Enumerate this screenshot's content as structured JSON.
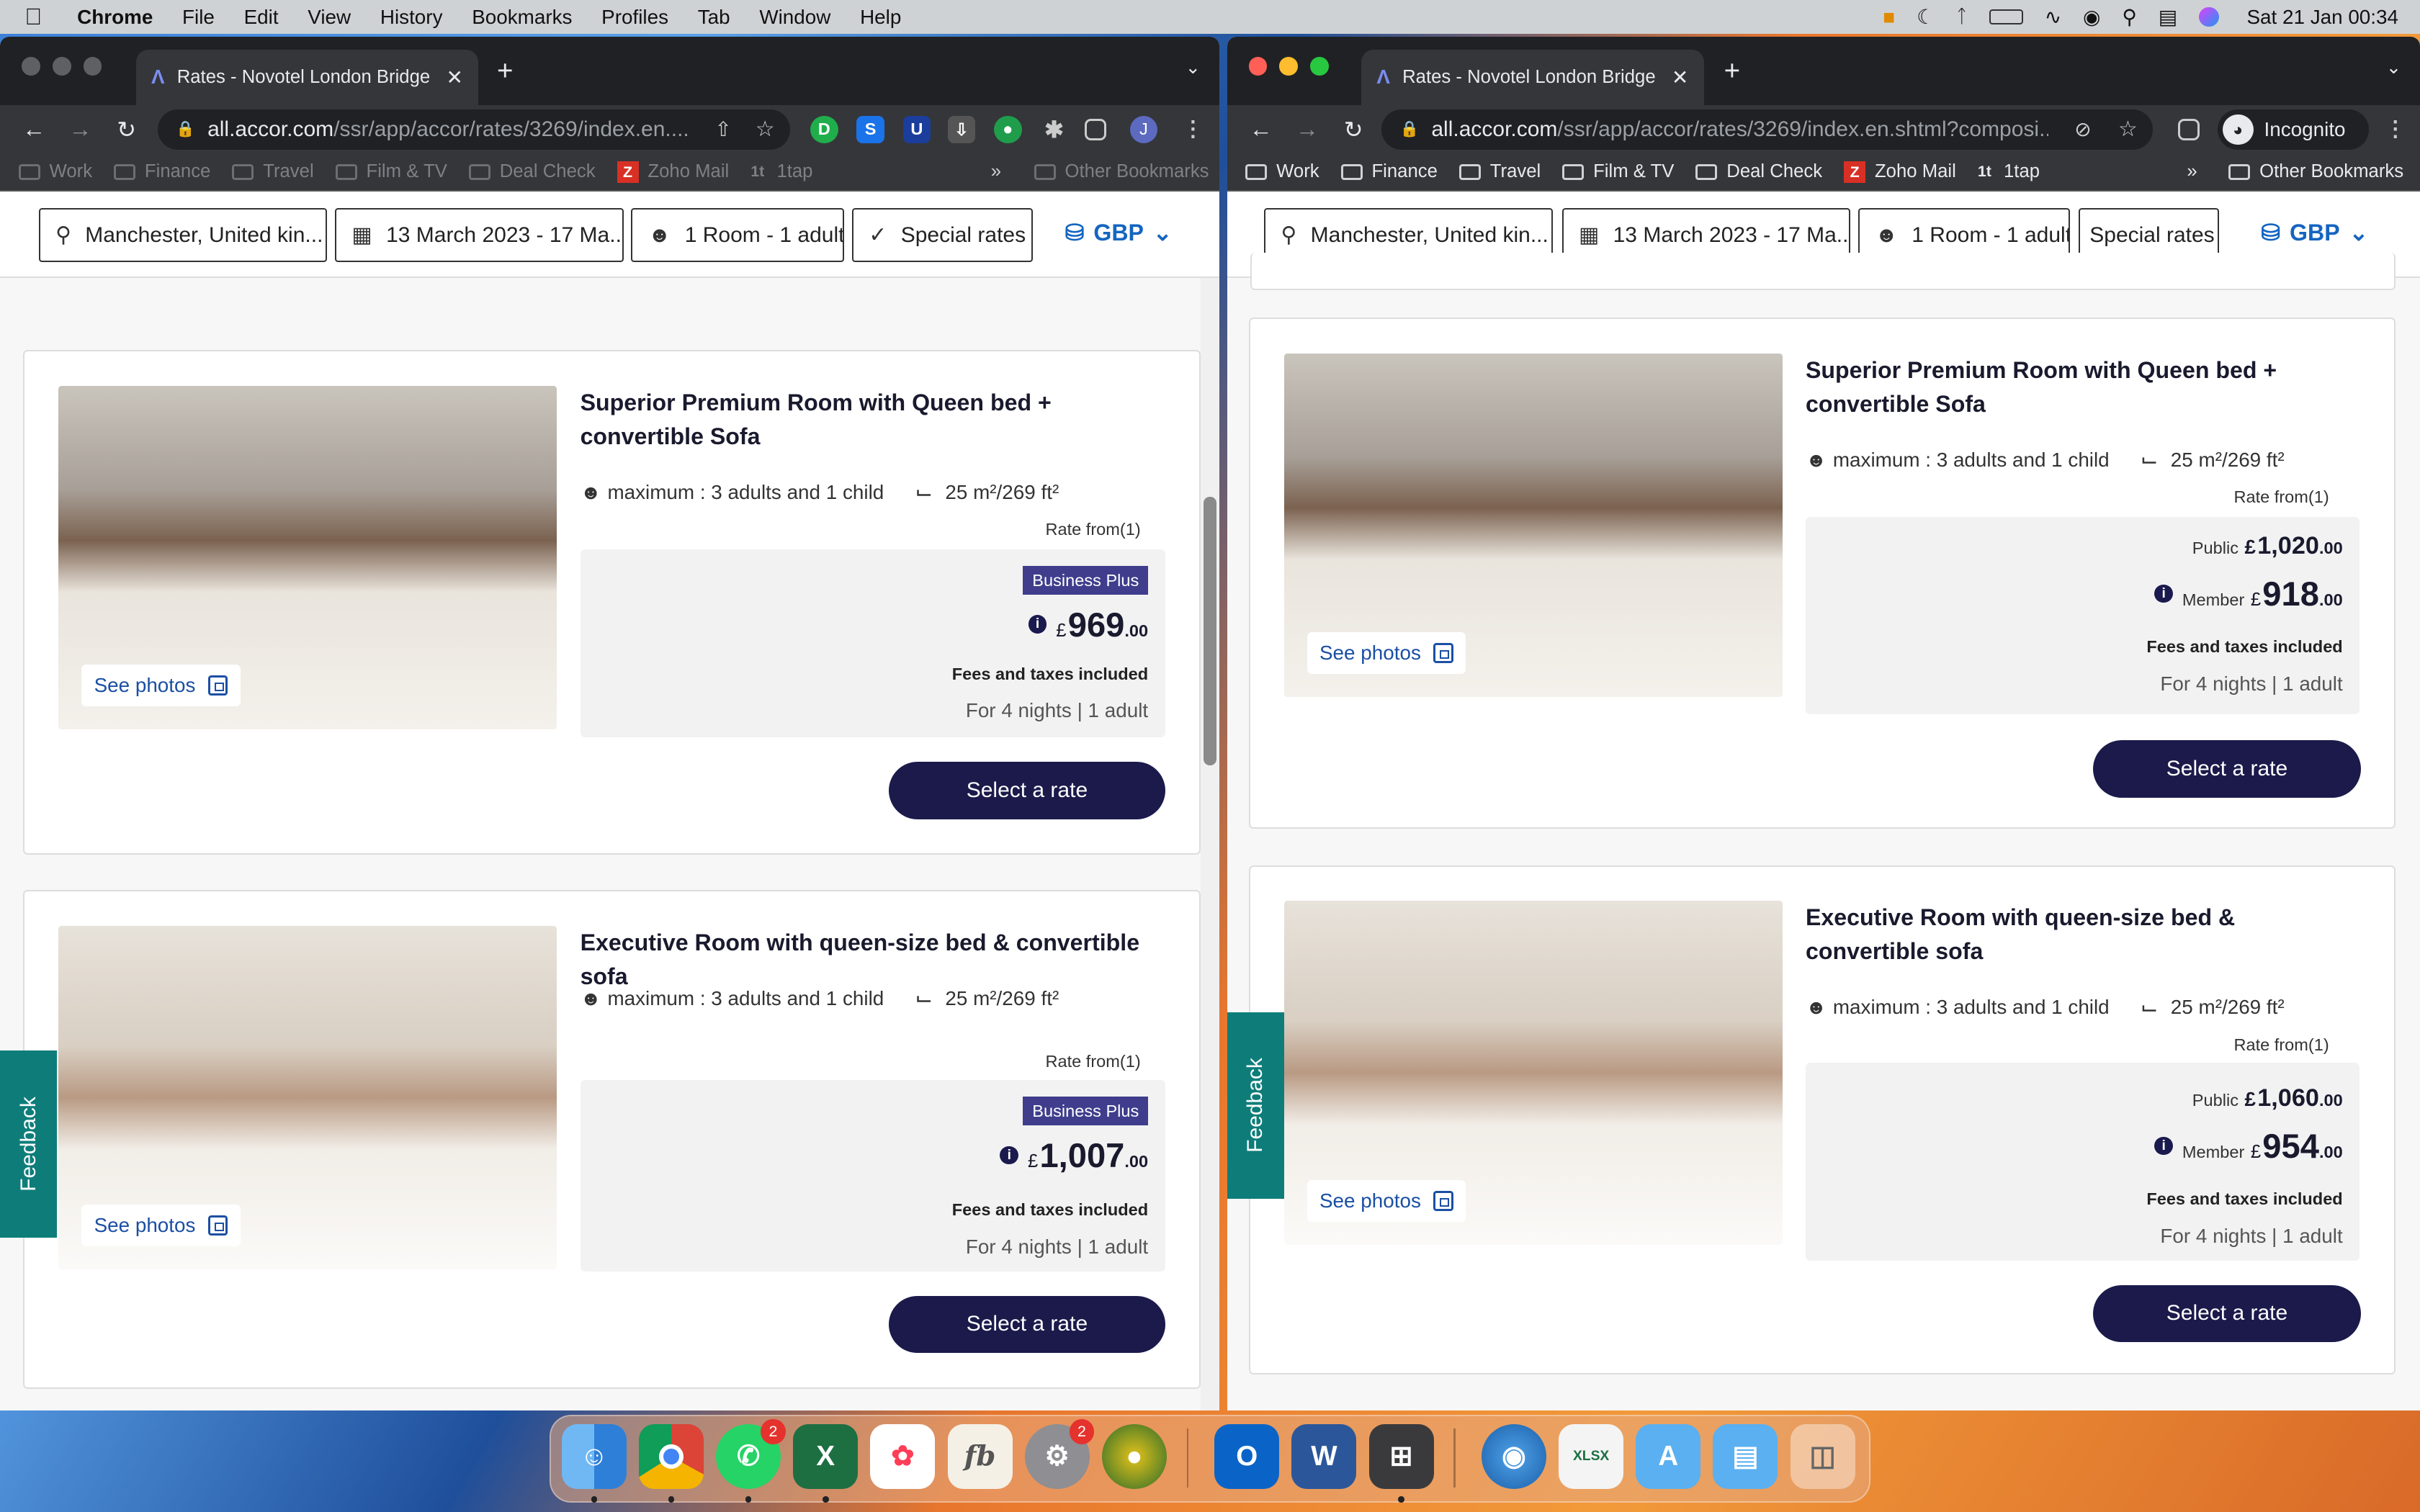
{
  "menubar": {
    "app": "Chrome",
    "items": [
      "File",
      "Edit",
      "View",
      "History",
      "Bookmarks",
      "Profiles",
      "Tab",
      "Window",
      "Help"
    ],
    "clock": "Sat 21 Jan  00:34"
  },
  "windows": [
    {
      "tab_title": "Rates - Novotel London Bridge",
      "url_host": "all.accor.com",
      "url_path": "/ssr/app/accor/rates/3269/index.en....",
      "profile_initial": "J",
      "bookmarks": [
        "Work",
        "Finance",
        "Travel",
        "Film & TV",
        "Deal Check",
        "Zoho Mail",
        "1tap"
      ],
      "other_bookmarks": "Other Bookmarks",
      "filters": {
        "destination": "Manchester, United kin...",
        "dates": "13 March 2023 - 17 Ma...",
        "guests": "1 Room - 1 adult",
        "special": "Special rates",
        "currency": "GBP"
      },
      "rooms": [
        {
          "title": "Superior Premium Room with Queen bed + convertible Sofa",
          "capacity": "maximum : 3 adults and 1 child",
          "area": "25 m²/269 ft²",
          "rate_from": "Rate from(1)",
          "badge": "Business Plus",
          "currency": "£",
          "price": "969",
          "decimals": ".00",
          "fees": "Fees and taxes included",
          "nights": "For 4 nights | 1 adult",
          "button": "Select a rate",
          "see_photos": "See photos"
        },
        {
          "title": "Executive Room with queen-size bed & convertible sofa",
          "capacity": "maximum : 3 adults and 1 child",
          "area": "25 m²/269 ft²",
          "rate_from": "Rate from(1)",
          "badge": "Business Plus",
          "currency": "£",
          "price": "1,007",
          "decimals": ".00",
          "fees": "Fees and taxes included",
          "nights": "For 4 nights | 1 adult",
          "button": "Select a rate",
          "see_photos": "See photos"
        }
      ],
      "feedback": "Feedback"
    },
    {
      "tab_title": "Rates - Novotel London Bridge",
      "url_host": "all.accor.com",
      "url_path": "/ssr/app/accor/rates/3269/index.en.shtml?composi...",
      "profile_label": "Incognito",
      "bookmarks": [
        "Work",
        "Finance",
        "Travel",
        "Film & TV",
        "Deal Check",
        "Zoho Mail",
        "1tap"
      ],
      "other_bookmarks": "Other Bookmarks",
      "filters": {
        "destination": "Manchester, United kin...",
        "dates": "13 March 2023 - 17 Ma...",
        "guests": "1 Room - 1 adult",
        "special": "Special rates",
        "currency": "GBP"
      },
      "rooms": [
        {
          "title": "Superior Premium Room with Queen bed + convertible Sofa",
          "capacity": "maximum : 3 adults and 1 child",
          "area": "25 m²/269 ft²",
          "rate_from": "Rate from(1)",
          "public_label": "Public",
          "public_currency": "£",
          "public_price": "1,020",
          "public_decimals": ".00",
          "member_label": "Member",
          "currency": "£",
          "price": "918",
          "decimals": ".00",
          "fees": "Fees and taxes included",
          "nights": "For 4 nights | 1 adult",
          "button": "Select a rate",
          "see_photos": "See photos"
        },
        {
          "title": "Executive Room with queen-size bed & convertible sofa",
          "capacity": "maximum : 3 adults and 1 child",
          "area": "25 m²/269 ft²",
          "rate_from": "Rate from(1)",
          "public_label": "Public",
          "public_currency": "£",
          "public_price": "1,060",
          "public_decimals": ".00",
          "member_label": "Member",
          "currency": "£",
          "price": "954",
          "decimals": ".00",
          "fees": "Fees and taxes included",
          "nights": "For 4 nights | 1 adult",
          "button": "Select a rate",
          "see_photos": "See photos"
        }
      ],
      "feedback": "Feedback"
    }
  ],
  "dock": {
    "apps": [
      "finder-icon",
      "chrome-icon",
      "whatsapp-icon",
      "excel-icon",
      "monday-icon",
      "fb-icon",
      "system-preferences-icon",
      "globe-app-icon",
      "outlook-icon",
      "word-icon",
      "calculator-icon",
      "world-icon",
      "xlsx-file-icon",
      "app-store-folder-icon",
      "folder-icon",
      "trash-icon"
    ],
    "whatsapp_badge": "2",
    "settings_badge": "2"
  }
}
